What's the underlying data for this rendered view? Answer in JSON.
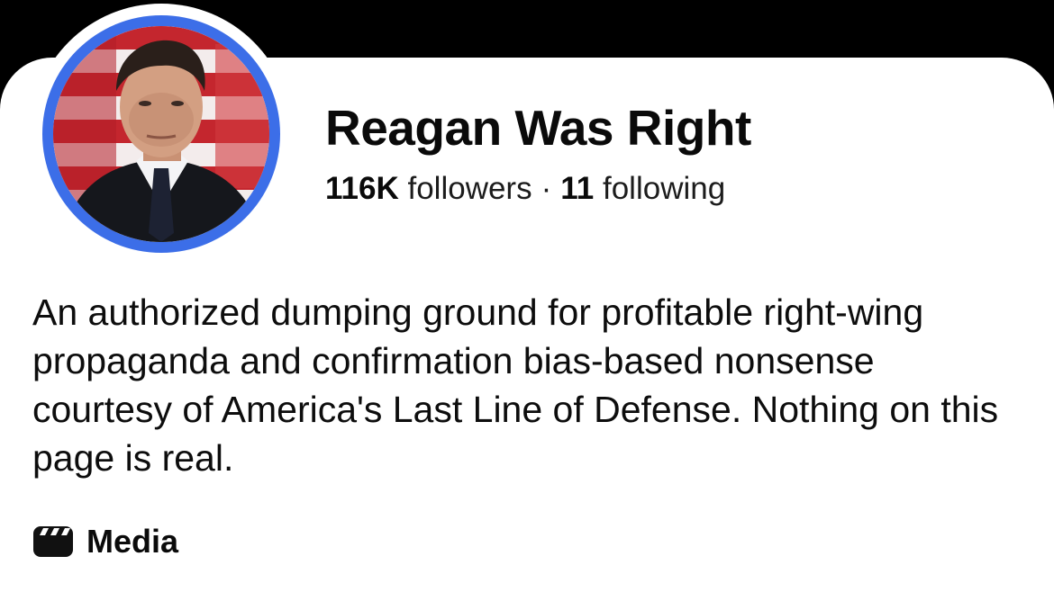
{
  "profile": {
    "name": "Reagan Was Right",
    "followers_count": "116K",
    "followers_label": "followers",
    "separator": "·",
    "following_count": "11",
    "following_label": "following",
    "bio": "An authorized dumping ground for profitable right-wing propaganda and confirmation bias-based nonsense courtesy of America's Last Line of Defense. Nothing on this page is real.",
    "avatar_ring_color": "#3c6ee8"
  },
  "tabs": {
    "media_label": "Media",
    "media_icon": "clapperboard-icon"
  }
}
